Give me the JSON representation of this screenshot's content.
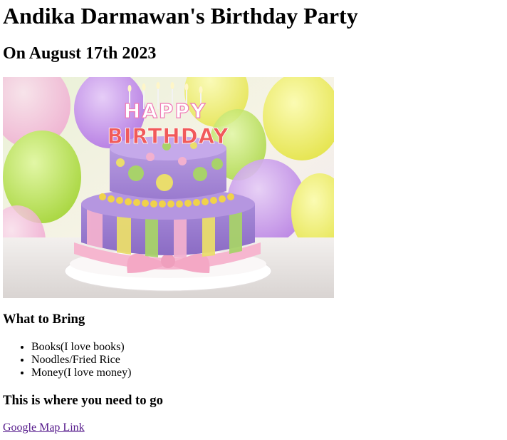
{
  "header": {
    "title": "Andika Darmawan's Birthday Party",
    "date": "On August 17th 2023"
  },
  "hero_image": {
    "cake_topper_line1": "HAPPY",
    "cake_topper_line2": "BIRTHDAY"
  },
  "bring": {
    "heading": "What to Bring",
    "items": [
      "Books(I love books)",
      "Noodles/Fried Rice",
      "Money(I love money)"
    ]
  },
  "location": {
    "heading": "This is where you need to go",
    "link_text": "Google Map Link"
  },
  "colors": {
    "link_visited": "#551a8b",
    "text": "#000000",
    "background": "#ffffff"
  }
}
